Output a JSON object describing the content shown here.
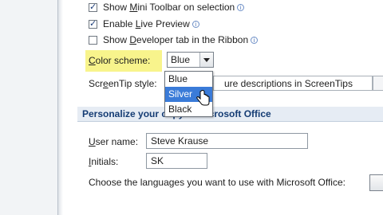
{
  "checkboxes": [
    {
      "label_pre": "Show ",
      "label_key": "M",
      "label_post": "ini Toolbar on selection",
      "checked": true,
      "has_info": true
    },
    {
      "label_pre": "Enable ",
      "label_key": "L",
      "label_post": "ive Preview",
      "checked": true,
      "has_info": true
    },
    {
      "label_pre": "Show ",
      "label_key": "D",
      "label_post": "eveloper tab in the Ribbon",
      "checked": false,
      "has_info": true
    }
  ],
  "color_scheme": {
    "label_key": "C",
    "label_post": "olor scheme:",
    "selected": "Blue",
    "options": [
      "Blue",
      "Silver",
      "Black"
    ],
    "hovered": "Silver"
  },
  "screentip": {
    "label_pre": "Scr",
    "label_key": "e",
    "label_post": "enTip style:",
    "value": "ure descriptions in ScreenTips"
  },
  "personalize": {
    "title": "Personalize your copy of Microsoft Office",
    "user_name_key": "U",
    "user_name_post": "ser name:",
    "user_name_value": "Steve Krause",
    "initials_key": "I",
    "initials_post": "nitials:",
    "initials_value": "SK",
    "languages_text": "Choose the languages you want to use with Microsoft Office:"
  },
  "colors": {
    "highlight": "#f8f48c",
    "selection": "#3a7bd8",
    "section_title": "#153c74"
  },
  "icons": [
    "info-icon",
    "dropdown-arrow-icon",
    "mouse-cursor-icon"
  ]
}
